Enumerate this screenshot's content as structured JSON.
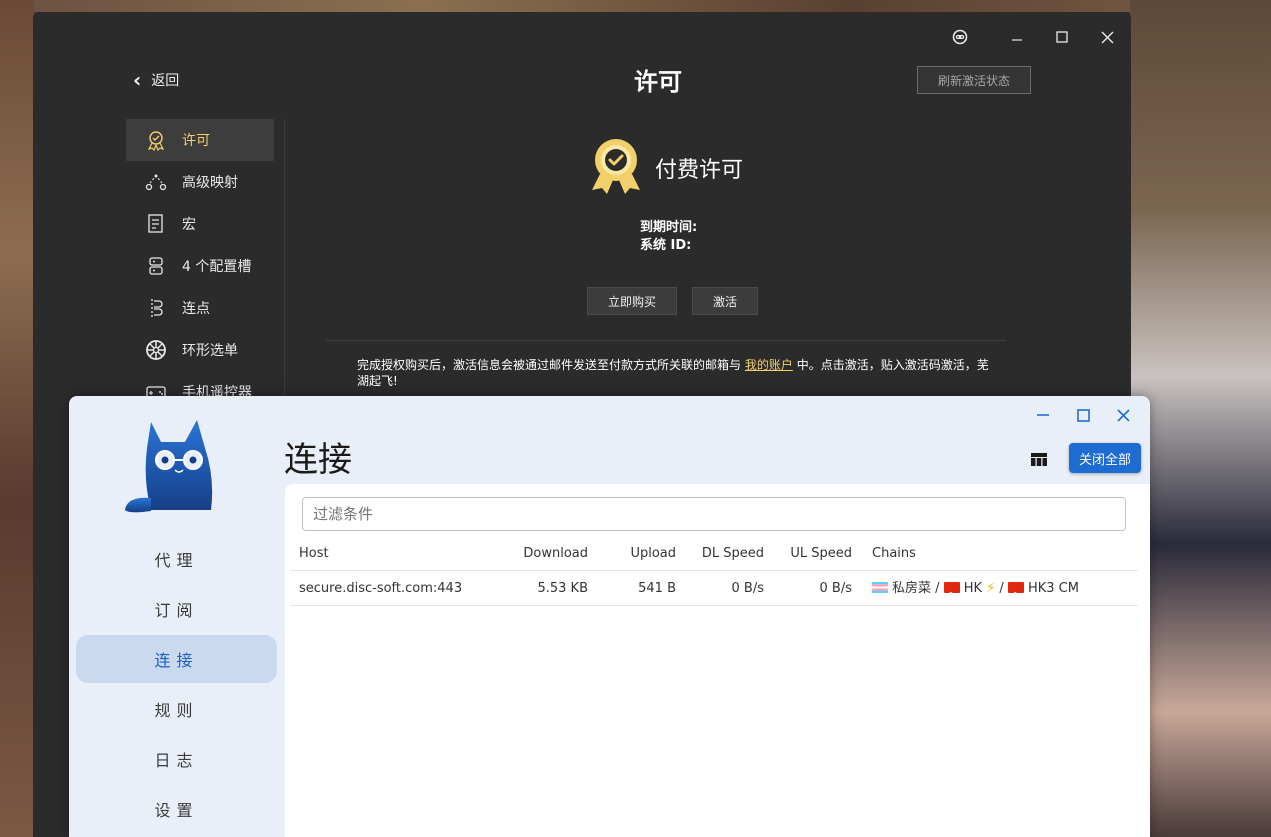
{
  "license_window": {
    "back_label": "返回",
    "title": "许可",
    "refresh_button": "刷新激活状态",
    "sidebar": [
      {
        "label": "许可",
        "icon": "badge-icon",
        "active": true
      },
      {
        "label": "高级映射",
        "icon": "mapping-icon",
        "active": false
      },
      {
        "label": "宏",
        "icon": "macro-icon",
        "active": false
      },
      {
        "label": "4 个配置槽",
        "icon": "slots-icon",
        "active": false
      },
      {
        "label": "连点",
        "icon": "turbo-icon",
        "active": false
      },
      {
        "label": "环形选单",
        "icon": "radial-menu-icon",
        "active": false
      },
      {
        "label": "手机遥控器",
        "icon": "phone-controller-icon",
        "active": false
      }
    ],
    "plan_title": "付费许可",
    "expiry_label": "到期时间:",
    "system_id_label": "系统 ID:",
    "buy_button": "立即购买",
    "activate_button": "激活",
    "note_prefix": "完成授权购买后，激活信息会被通过邮件发送至付款方式所关联的邮箱与",
    "note_link": "我的账户",
    "note_suffix": "中。点击激活，贴入激活码激活，芜湖起飞!",
    "colors": {
      "accent": "#f2d06b",
      "background": "#2b2b2b"
    }
  },
  "clash_window": {
    "nav": [
      {
        "label": "代理",
        "active": false
      },
      {
        "label": "订阅",
        "active": false
      },
      {
        "label": "连接",
        "active": true
      },
      {
        "label": "规则",
        "active": false
      },
      {
        "label": "日志",
        "active": false
      },
      {
        "label": "设置",
        "active": false
      }
    ],
    "title": "连接",
    "close_all_button": "关闭全部",
    "filter_placeholder": "过滤条件",
    "table": {
      "headers": {
        "host": "Host",
        "download": "Download",
        "upload": "Upload",
        "dl_speed": "DL Speed",
        "ul_speed": "UL Speed",
        "chains": "Chains"
      },
      "rows": [
        {
          "host": "secure.disc-soft.com:443",
          "download": "5.53 KB",
          "upload": "541 B",
          "dl_speed": "0 B/s",
          "ul_speed": "0 B/s",
          "chain_1": "私房菜",
          "chain_sep_1": "/",
          "chain_2": "HK",
          "chain_2_emoji": "⚡",
          "chain_sep_2": "/",
          "chain_3": "HK3 CM"
        }
      ]
    },
    "colors": {
      "accent": "#1e6bd1",
      "nav_active_bg": "#c9daf0"
    }
  }
}
